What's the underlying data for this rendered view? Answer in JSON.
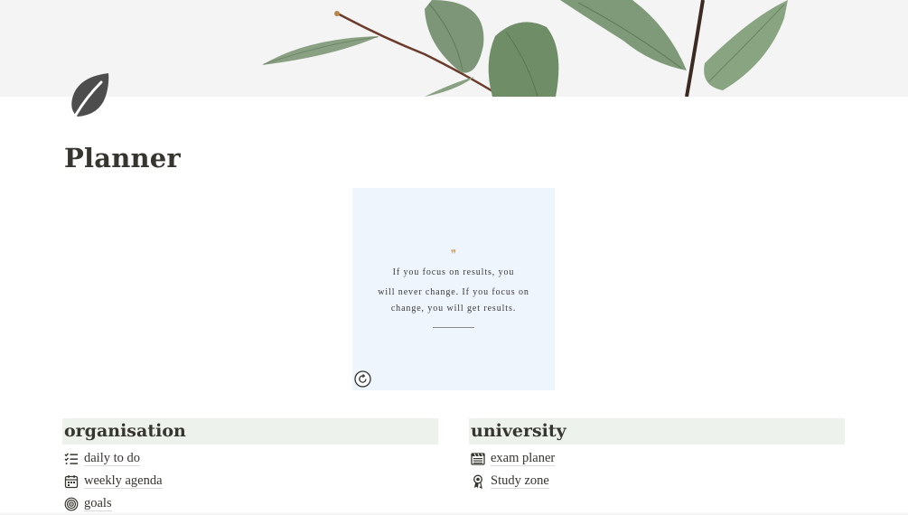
{
  "page": {
    "title": "Planner",
    "cover_image": "eucalyptus-branch-cover",
    "page_icon": "leaf-icon"
  },
  "quote_widget": {
    "mark": "❞",
    "lines": [
      "If you focus on results, you",
      "will never change. If you focus on",
      "change, you will get results."
    ],
    "refresh_icon": "refresh-icon"
  },
  "sections": [
    {
      "heading": "organisation",
      "links": [
        {
          "label": "daily to do",
          "icon": "checklist-icon"
        },
        {
          "label": "weekly agenda",
          "icon": "calendar-icon"
        },
        {
          "label": "goals",
          "icon": "target-icon"
        }
      ]
    },
    {
      "heading": "university",
      "links": [
        {
          "label": "exam planer",
          "icon": "clapperboard-icon"
        },
        {
          "label": "Study zone",
          "icon": "award-ribbon-icon"
        }
      ]
    }
  ],
  "colors": {
    "text": "#37352f",
    "section_bg": "#edf3ec",
    "quote_bg": "#eff5fd",
    "quote_mark": "#c9a46a",
    "cover_bg": "#f4f4f5"
  }
}
